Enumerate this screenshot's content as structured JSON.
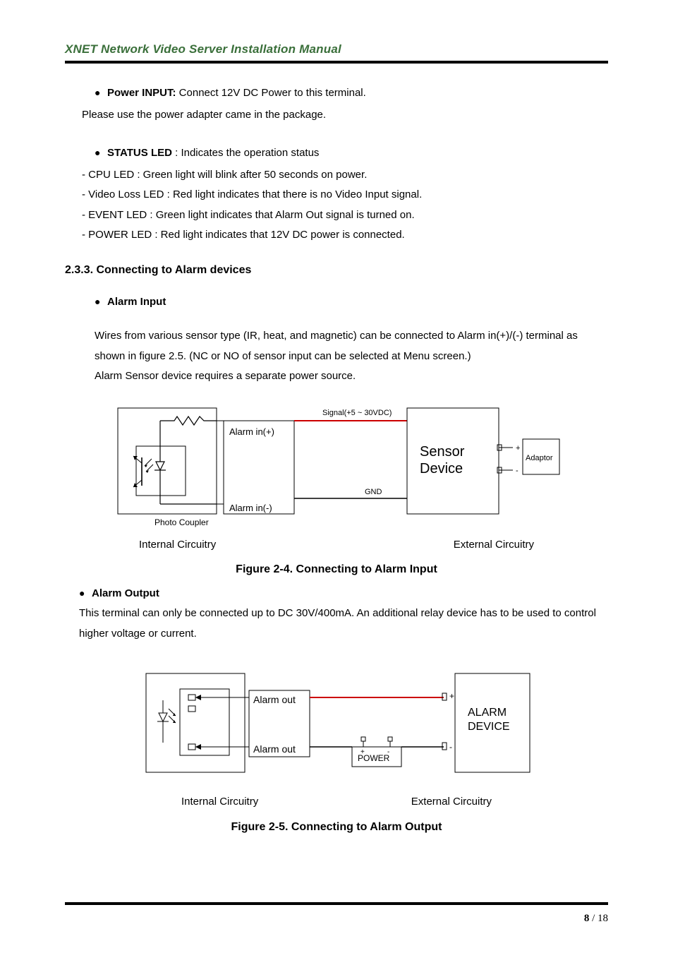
{
  "header": {
    "title": "XNET Network Video Server Installation Manual"
  },
  "content": {
    "power_input_label": "Power INPUT:",
    "power_input_desc": " Connect 12V DC Power to this terminal.",
    "power_input_note": "Please use the power adapter came in the package.",
    "status_led_label": "STATUS LED",
    "status_led_desc": " : Indicates the operation status",
    "status_items": [
      "- CPU LED : Green light will blink after 50 seconds on power.",
      "- Video Loss LED : Red light indicates that there is no Video Input signal.",
      "- EVENT LED : Green light indicates that Alarm Out signal is turned on.",
      "- POWER LED : Red light indicates that 12V DC power is connected."
    ],
    "section_233": "2.3.3. Connecting to Alarm devices",
    "alarm_input_label": "Alarm Input",
    "alarm_input_para": "Wires from various sensor type (IR, heat, and magnetic) can be connected to Alarm in(+)/(-) terminal as shown in figure 2.5. (NC or NO of sensor input can be selected at Menu screen.)",
    "alarm_input_para2": "Alarm Sensor device requires a separate power source.",
    "fig24_labels": {
      "signal": "Signal(+5 ~ 30VDC)",
      "alarm_in_plus": "Alarm in(+)",
      "alarm_in_minus": "Alarm in(-)",
      "gnd": "GND",
      "photo_coupler": "Photo Coupler",
      "sensor_device_1": "Sensor",
      "sensor_device_2": "Device",
      "adaptor": "Adaptor",
      "plus": "+",
      "minus": "-",
      "internal": "Internal Circuitry",
      "external": "External Circuitry"
    },
    "fig24_caption": "Figure 2-4. Connecting to Alarm Input",
    "alarm_output_label": "Alarm Output",
    "alarm_output_para": "This terminal can only be connected up to DC 30V/400mA.   An additional relay device has to be used to control higher voltage or current.",
    "fig25_labels": {
      "alarm_out": "Alarm out",
      "alarm_out2": "Alarm out",
      "power": "POWER",
      "plus": "+",
      "minus": "-",
      "alarm_device_1": "ALARM",
      "alarm_device_2": "DEVICE",
      "plus2": "+",
      "minus2": "-",
      "internal": "Internal Circuitry",
      "external": "External Circuitry"
    },
    "fig25_caption": "Figure 2-5. Connecting to Alarm Output"
  },
  "footer": {
    "page_current": "8",
    "page_sep": " / ",
    "page_total": "18"
  }
}
